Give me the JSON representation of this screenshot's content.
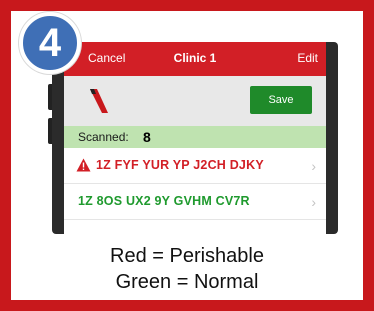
{
  "step_number": "4",
  "nav": {
    "left_label": "Cancel",
    "title": "Clinic 1",
    "right_label": "Edit"
  },
  "toolbar": {
    "save_label": "Save"
  },
  "scanned": {
    "label": "Scanned:",
    "count": "8"
  },
  "items": [
    {
      "code": "1Z FYF YUR YP J2CH DJKY",
      "status": "perishable",
      "color": "#d21f26"
    },
    {
      "code": "1Z 8OS UX2 9Y GVHM CV7R",
      "status": "normal",
      "color": "#1f9a2e"
    }
  ],
  "legend": {
    "line1": "Red = Perishable",
    "line2": "Green = Normal"
  },
  "colors": {
    "frame": "#c8181c",
    "nav": "#d21f26",
    "badge": "#3f6fb6",
    "save": "#1f8a2a",
    "scanned_bg": "#bfe3b0"
  }
}
